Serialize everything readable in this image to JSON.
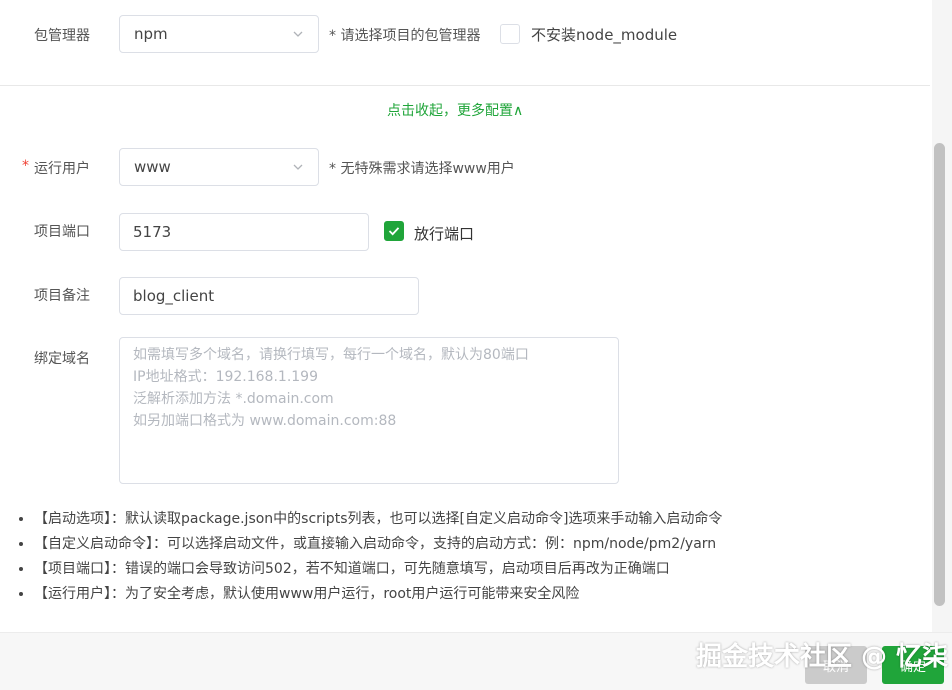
{
  "package_manager": {
    "label": "包管理器",
    "value": "npm",
    "hint": "* 请选择项目的包管理器",
    "no_install_label": "不安装node_module"
  },
  "toggle_link": "点击收起，更多配置∧",
  "run_user": {
    "required_mark": "*",
    "label": "运行用户",
    "value": "www",
    "hint": "* 无特殊需求请选择www用户"
  },
  "port": {
    "label": "项目端口",
    "value": "5173",
    "open_port_label": "放行端口",
    "open_port_checked": true
  },
  "remark": {
    "label": "项目备注",
    "value": "blog_client"
  },
  "domain": {
    "label": "绑定域名",
    "placeholder_lines": [
      "如需填写多个域名，请换行填写，每行一个域名，默认为80端口",
      "IP地址格式：192.168.1.199",
      "泛解析添加方法 *.domain.com",
      "如另加端口格式为 www.domain.com:88"
    ]
  },
  "notes": [
    "【启动选项】：默认读取package.json中的scripts列表，也可以选择[自定义启动命令]选项来手动输入启动命令",
    "【自定义启动命令】：可以选择启动文件，或直接输入启动命令，支持的启动方式：例：npm/node/pm2/yarn",
    "【项目端口】：错误的端口会导致访问502，若不知道端口，可先随意填写，启动项目后再改为正确端口",
    "【运行用户】：为了安全考虑，默认使用www用户运行，root用户运行可能带来安全风险"
  ],
  "footer": {
    "cancel_label": "取消",
    "confirm_label": "确定"
  },
  "watermark": "掘金技术社区 @ 忆柒",
  "colors": {
    "accent_green": "#20a53a",
    "required_red": "#f04134",
    "cancel_gray": "#cbcbcb"
  },
  "icons": {
    "select_arrow": "chevron-down-icon",
    "check": "checkmark-icon",
    "collapse": "chevron-up-icon"
  }
}
